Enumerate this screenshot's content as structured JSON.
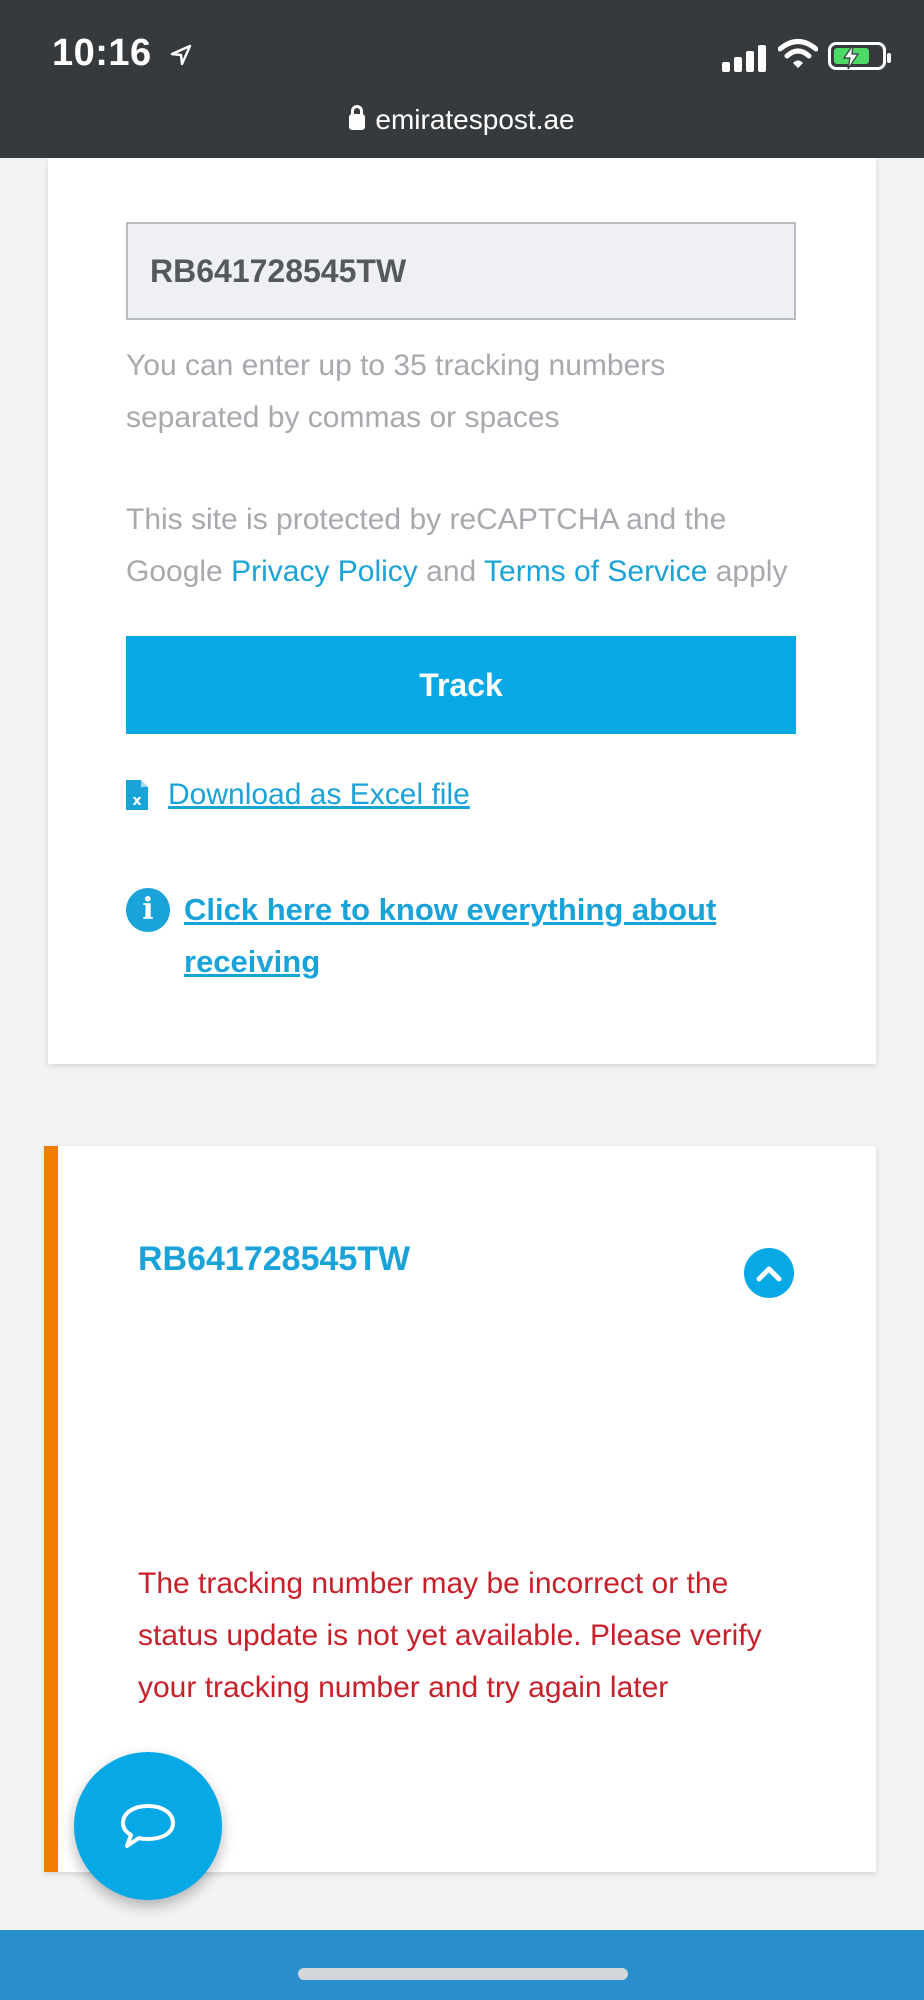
{
  "status_bar": {
    "time": "10:16",
    "url": "emiratespost.ae"
  },
  "tracking_form": {
    "input_value": "RB641728545TW",
    "hint": "You can enter up to 35 tracking numbers separated by commas or spaces",
    "captcha_prefix": "This site is protected by reCAPTCHA and the Google",
    "privacy_link": "Privacy Policy",
    "captcha_and": "and",
    "terms_link": "Terms of Service",
    "captcha_suffix": "apply",
    "track_button": "Track",
    "excel_link": "Download as Excel file",
    "info_link": "Click here to know everything about receiving"
  },
  "result": {
    "tracking_number": "RB641728545TW",
    "error_message": "The tracking number may be incorrect or the status update is not yet available. Please verify your tracking number and try again later"
  },
  "colors": {
    "brand_blue": "#06a8e6",
    "link_blue": "#1aa3d9",
    "accent_orange": "#f07d00",
    "error_red": "#c8202a"
  },
  "icons": [
    "location-arrow-icon",
    "signal-icon",
    "wifi-icon",
    "battery-charging-icon",
    "lock-icon",
    "excel-file-icon",
    "info-icon",
    "chevron-up-icon",
    "chat-bubble-icon"
  ]
}
